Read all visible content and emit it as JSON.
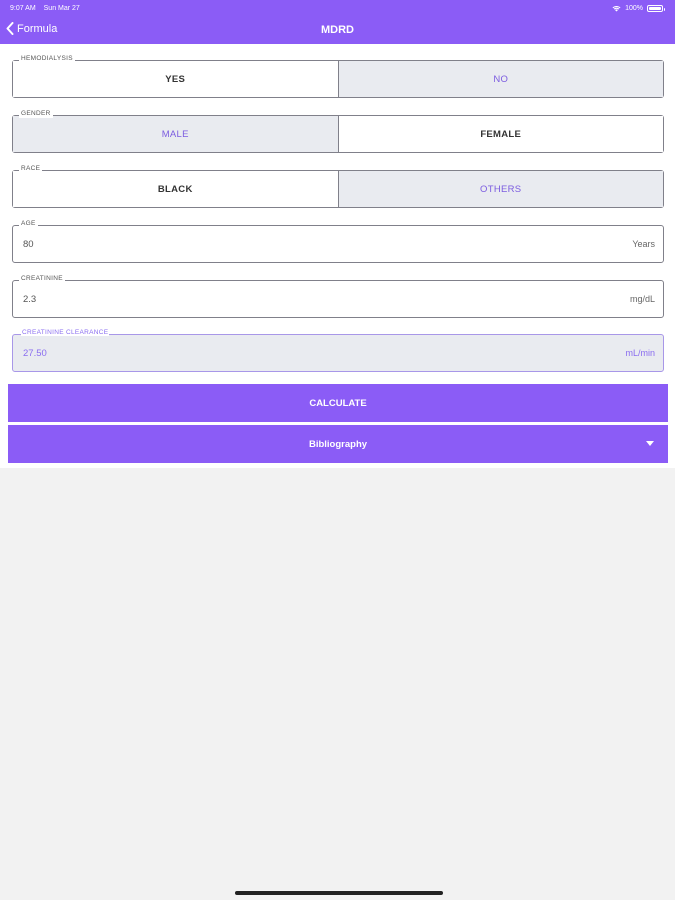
{
  "status": {
    "time": "9:07 AM",
    "date": "Sun Mar 27",
    "battery": "100%"
  },
  "nav": {
    "back_label": "Formula",
    "title": "MDRD"
  },
  "hemodialysis": {
    "label": "HEMODIALYSIS",
    "yes": "YES",
    "no": "NO",
    "selected": "YES"
  },
  "gender": {
    "label": "GENDER",
    "male": "MALE",
    "female": "FEMALE",
    "selected": "FEMALE"
  },
  "race": {
    "label": "RACE",
    "black": "BLACK",
    "others": "OTHERS",
    "selected": "BLACK"
  },
  "age": {
    "label": "AGE",
    "value": "80",
    "unit": "Years"
  },
  "creatinine": {
    "label": "CREATININE",
    "value": "2.3",
    "unit": "mg/dL"
  },
  "clearance": {
    "label": "CREATININE CLEARANCE",
    "value": "27.50",
    "unit": "mL/min"
  },
  "calculate_label": "CALCULATE",
  "bibliography_label": "Bibliography",
  "colors": {
    "accent": "#8b5cf6",
    "unselected_bg": "#e9ebf0",
    "background": "#f2f2f2"
  }
}
